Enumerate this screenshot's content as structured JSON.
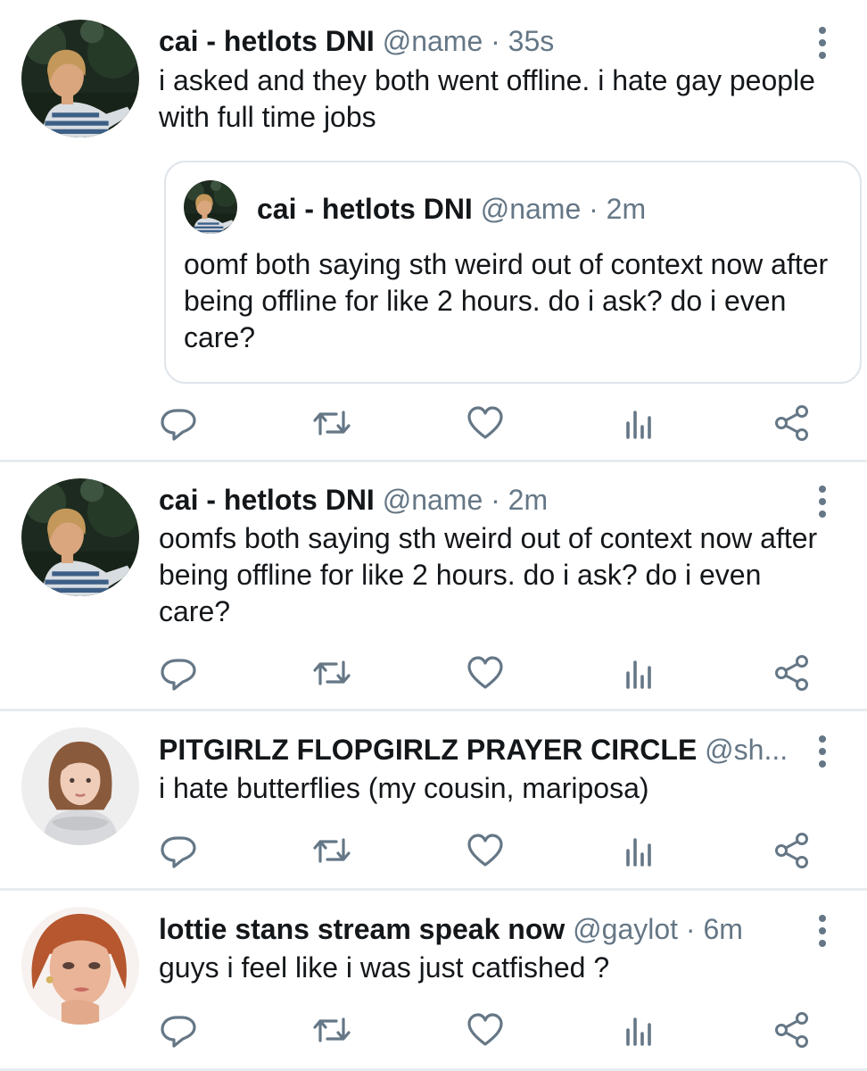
{
  "tweets": [
    {
      "name": "cai - hetlots DNI",
      "handle": "@name",
      "dot": "·",
      "time": "35s",
      "text": "i asked and they both went offline. i hate gay people with full time jobs",
      "quote": {
        "name": "cai - hetlots DNI",
        "handle": "@name",
        "dot": "·",
        "time": "2m",
        "text": "oomf both saying sth weird out of context now after being offline for like 2 hours. do i ask? do i even care?"
      }
    },
    {
      "name": "cai - hetlots DNI",
      "handle": "@name",
      "dot": "·",
      "time": "2m",
      "text": "oomfs both saying sth weird out of context now after being offline for like 2 hours. do i ask? do i even care?"
    },
    {
      "name": "PITGIRLZ FLOPGIRLZ PRAYER CIRCLE",
      "handle": "@sh...",
      "text": "i hate butterflies (my cousin, mariposa)"
    },
    {
      "name": "lottie stans stream speak now",
      "handle": "@gaylot",
      "dot": "·",
      "time": "6m",
      "text": "guys i feel like i was just catfished ?"
    }
  ],
  "icons": {
    "more": "more-vertical-icon",
    "reply": "reply-icon",
    "retweet": "retweet-icon",
    "like": "like-icon",
    "analytics": "analytics-icon",
    "share": "share-icon"
  },
  "colors": {
    "text": "#14171a",
    "secondary": "#657786",
    "divider": "#e6ecf0"
  }
}
